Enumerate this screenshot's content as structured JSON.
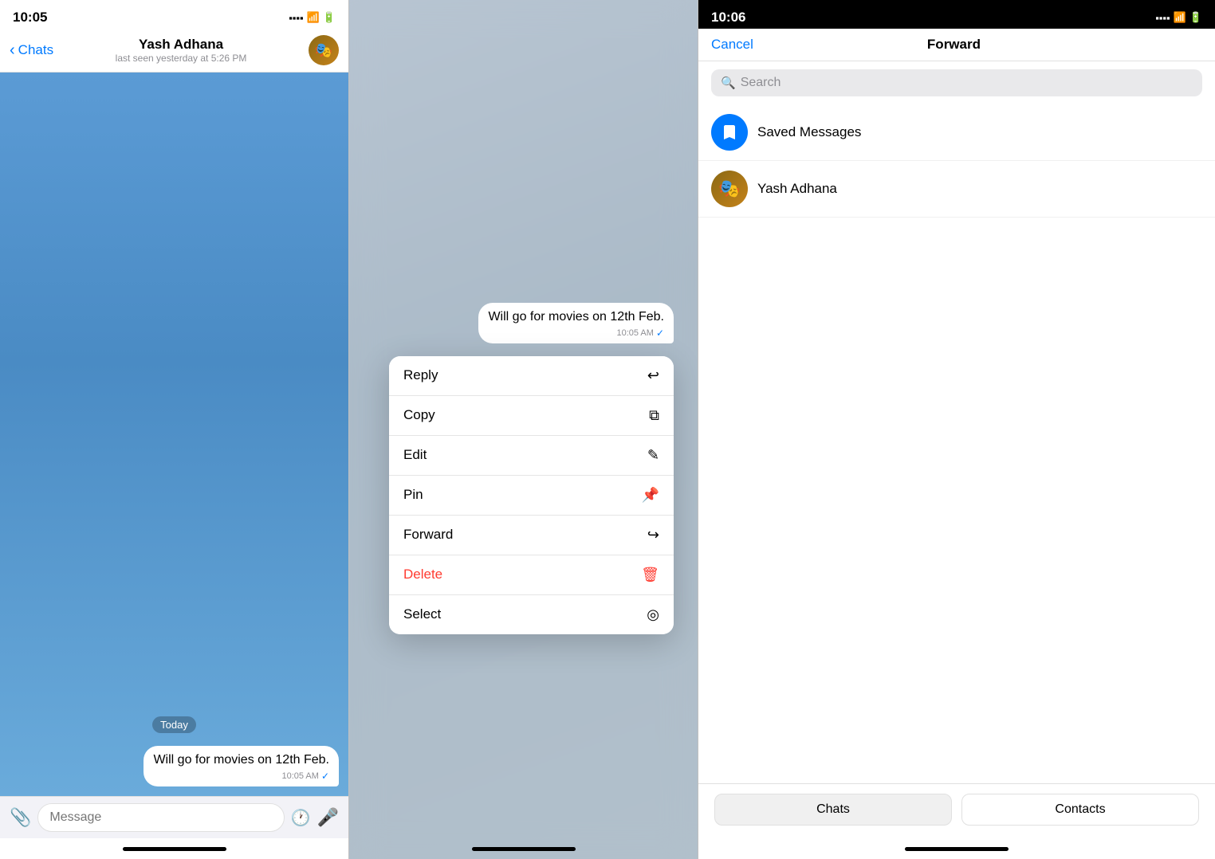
{
  "panel1": {
    "statusBar": {
      "time": "10:05"
    },
    "navBar": {
      "backLabel": "Chats",
      "contactName": "Yash Adhana",
      "lastSeen": "last seen yesterday at 5:26 PM"
    },
    "dateBadge": "Today",
    "message": {
      "text": "Will go for movies on 12th Feb.",
      "time": "10:05 AM",
      "check": "✓"
    },
    "inputBar": {
      "placeholder": "Message"
    }
  },
  "panel2": {
    "message": {
      "text": "Will go for movies on 12th Feb.",
      "time": "10:05 AM",
      "check": "✓"
    },
    "contextMenu": {
      "items": [
        {
          "label": "Reply",
          "icon": "↩",
          "isDelete": false
        },
        {
          "label": "Copy",
          "icon": "⧉",
          "isDelete": false
        },
        {
          "label": "Edit",
          "icon": "✎",
          "isDelete": false
        },
        {
          "label": "Pin",
          "icon": "⊕",
          "isDelete": false
        },
        {
          "label": "Forward",
          "icon": "↪",
          "isDelete": false
        },
        {
          "label": "Delete",
          "icon": "🗑",
          "isDelete": true
        },
        {
          "label": "Select",
          "icon": "◎",
          "isDelete": false
        }
      ]
    }
  },
  "panel3": {
    "statusBar": {
      "time": "10:06"
    },
    "navBar": {
      "cancelLabel": "Cancel",
      "title": "Forward"
    },
    "searchBar": {
      "placeholder": "Search"
    },
    "listItems": [
      {
        "name": "Saved Messages",
        "avatarType": "saved",
        "avatarIcon": "🔖"
      },
      {
        "name": "Yash Adhana",
        "avatarType": "yash",
        "avatarIcon": "👤"
      }
    ],
    "bottomTabs": [
      {
        "label": "Chats",
        "active": true
      },
      {
        "label": "Contacts",
        "active": false
      }
    ]
  }
}
